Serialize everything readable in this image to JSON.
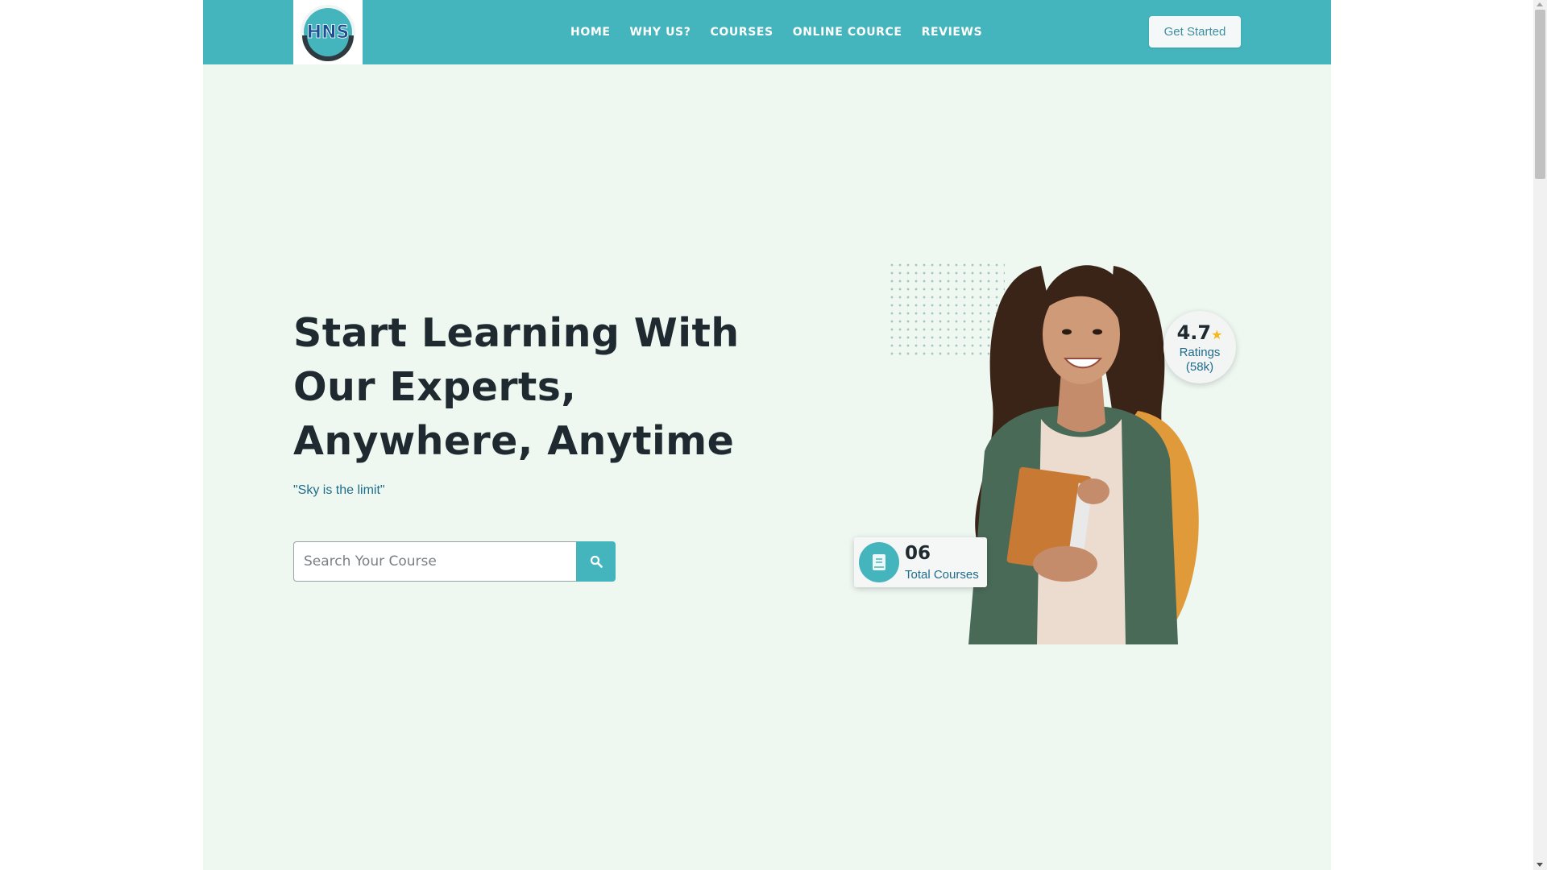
{
  "brand": {
    "logo_text": "HNS",
    "logo_ring_text": "HOME OF NURSING STUDIES"
  },
  "nav": {
    "items": [
      {
        "label": "HOME"
      },
      {
        "label": "WHY US?"
      },
      {
        "label": "COURSES"
      },
      {
        "label": "ONLINE COURCE"
      },
      {
        "label": "REVIEWS"
      }
    ],
    "cta_label": "Get Started"
  },
  "hero": {
    "title": "Start Learning With Our Experts, Anywhere, Anytime",
    "tagline": "\"Sky is the limit\"",
    "search": {
      "placeholder": "Search Your Course",
      "value": "",
      "button_icon": "search-icon"
    }
  },
  "rating_badge": {
    "value": "4.7",
    "star": "★",
    "label": "Ratings",
    "count": "(58k)"
  },
  "courses_card": {
    "icon": "book-icon",
    "count": "06",
    "label": "Total Courses"
  },
  "colors": {
    "brand_teal": "#45b5bd",
    "hero_bg": "#eef8f1",
    "heading": "#1f2a30",
    "accent_text": "#1f6c8b",
    "star": "#f5b81c"
  }
}
